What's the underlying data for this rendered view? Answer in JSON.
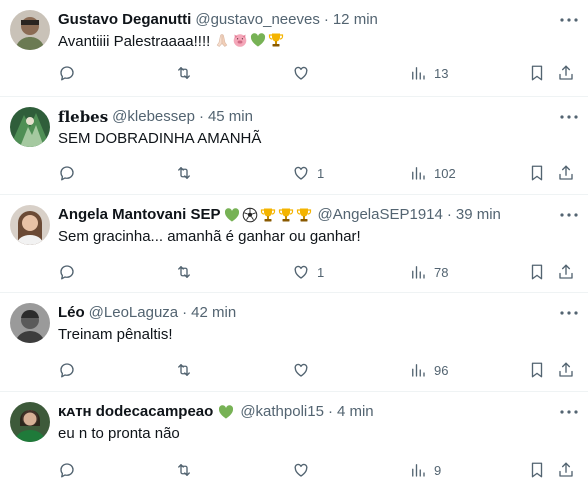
{
  "tweets": [
    {
      "name": "Gustavo Deganutti",
      "handle": "@gustavo_neeves",
      "time": "12 min",
      "text": "Avantiiii Palestraaaa!!!! ",
      "text_emojis": [
        "folded-hands",
        "pig-face",
        "green-heart",
        "trophy"
      ],
      "replies": "",
      "retweets": "",
      "likes": "",
      "views": "13"
    },
    {
      "name": "𝐟𝐥𝐞𝐛𝐞𝐬",
      "handle": "@klebessep",
      "time": "45 min",
      "text": "SEM DOBRADINHA AMANHÃ",
      "replies": "",
      "retweets": "",
      "likes": "1",
      "views": "102"
    },
    {
      "name": "Angela Mantovani SEP",
      "name_emojis": [
        "green-heart",
        "soccer-ball",
        "trophy",
        "trophy",
        "trophy"
      ],
      "handle": "@AngelaSEP1914",
      "time": "39 min",
      "text": "Sem gracinha... amanhã é ganhar ou ganhar!",
      "replies": "",
      "retweets": "",
      "likes": "1",
      "views": "78"
    },
    {
      "name": "Léo",
      "handle": "@LeoLaguza",
      "time": "42 min",
      "text": "Treinam pênaltis!",
      "replies": "",
      "retweets": "",
      "likes": "",
      "views": "96"
    },
    {
      "name": "ᴋᴀᴛʜ dodecacampeao",
      "name_emojis": [
        "green-heart"
      ],
      "handle": "@kathpoli15",
      "time": "4 min",
      "text": "eu n to pronta não",
      "replies": "",
      "retweets": "",
      "likes": "",
      "views": "9"
    }
  ],
  "separator": "·",
  "icons": [
    "reply-icon",
    "retweet-icon",
    "like-icon",
    "views-icon",
    "bookmark-icon",
    "share-icon",
    "more-icon"
  ],
  "colors": {
    "text": "#0f1419",
    "muted": "#536471",
    "border": "#eff3f4",
    "green-heart": "#77b255",
    "trophy": "#f4b400"
  }
}
